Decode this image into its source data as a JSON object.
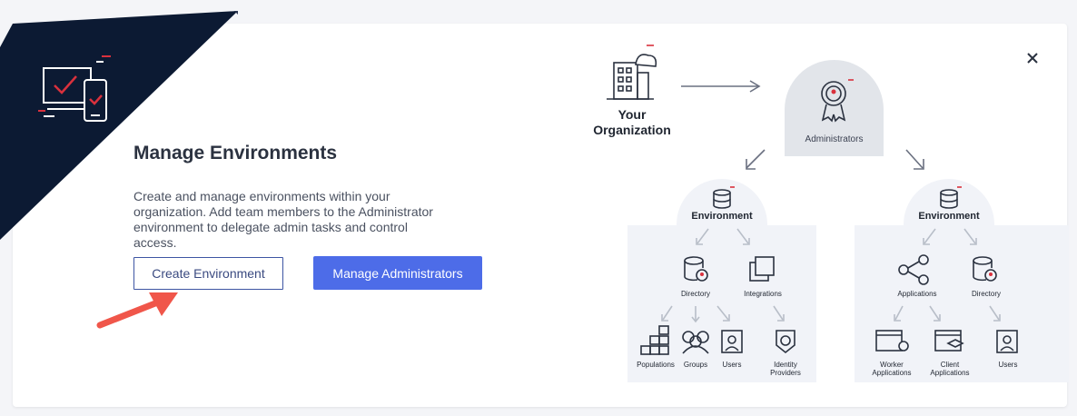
{
  "modal": {
    "title": "Manage Environments",
    "description": "Create and manage environments within your organization. Add team members to the Administrator environment to delegate admin tasks and control access.",
    "create_button": "Create Environment",
    "manage_button": "Manage Administrators",
    "close_icon": "close-icon"
  },
  "diagram": {
    "organization": "Your Organization",
    "administrators": "Administrators",
    "environment_left": {
      "title": "Environment",
      "directory": "Directory",
      "integrations": "Integrations",
      "populations": "Populations",
      "groups": "Groups",
      "users": "Users",
      "identity_providers": "Identity Providers"
    },
    "environment_right": {
      "title": "Environment",
      "applications": "Applications",
      "directory": "Directory",
      "worker_applications": "Worker Applications",
      "client_applications": "Client Applications",
      "users": "Users"
    }
  },
  "colors": {
    "navy": "#0c1a33",
    "accent_red": "#d9313d",
    "primary_blue": "#4d6ce8",
    "callout_arrow": "#f0564a"
  }
}
